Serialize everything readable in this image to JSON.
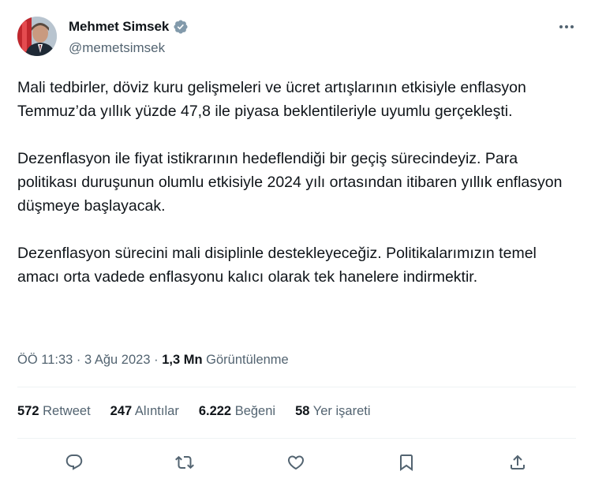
{
  "author": {
    "name": "Mehmet Simsek",
    "handle": "@memetsimsek",
    "verified_icon": "verified-badge-icon",
    "avatar_icon": "profile-photo"
  },
  "menu_icon": "more-options-icon",
  "tweet": {
    "paragraphs": [
      "Mali tedbirler, döviz kuru gelişmeleri ve ücret artışlarının etkisiyle enflasyon Temmuz’da yıllık yüzde 47,8 ile piyasa beklentileriyle uyumlu gerçekleşti.",
      "Dezenflasyon ile fiyat istikrarının hedeflendiği bir geçiş sürecindeyiz. Para politikası duruşunun olumlu etkisiyle 2024 yılı ortasından itibaren yıllık enflasyon düşmeye başlayacak.",
      "Dezenflasyon sürecini mali disiplinle destekleyeceğiz. Politikalarımızın temel amacı orta vadede enflasyonu kalıcı olarak tek hanelere indirmektir."
    ]
  },
  "meta": {
    "time": "ÖÖ 11:33",
    "separator": "·",
    "date": "3 Ağu 2023",
    "views_count": "1,3 Mn",
    "views_label": "Görüntülenme"
  },
  "stats": {
    "retweets": {
      "count": "572",
      "label": "Retweet"
    },
    "quotes": {
      "count": "247",
      "label": "Alıntılar"
    },
    "likes": {
      "count": "6.222",
      "label": "Beğeni"
    },
    "bookmarks": {
      "count": "58",
      "label": "Yer işareti"
    }
  },
  "actions": [
    "reply-icon",
    "retweet-icon",
    "like-icon",
    "bookmark-icon",
    "share-icon"
  ],
  "colors": {
    "text": "#0f1419",
    "secondary": "#536471",
    "verified": "#829aab",
    "divider": "#eff3f4"
  }
}
